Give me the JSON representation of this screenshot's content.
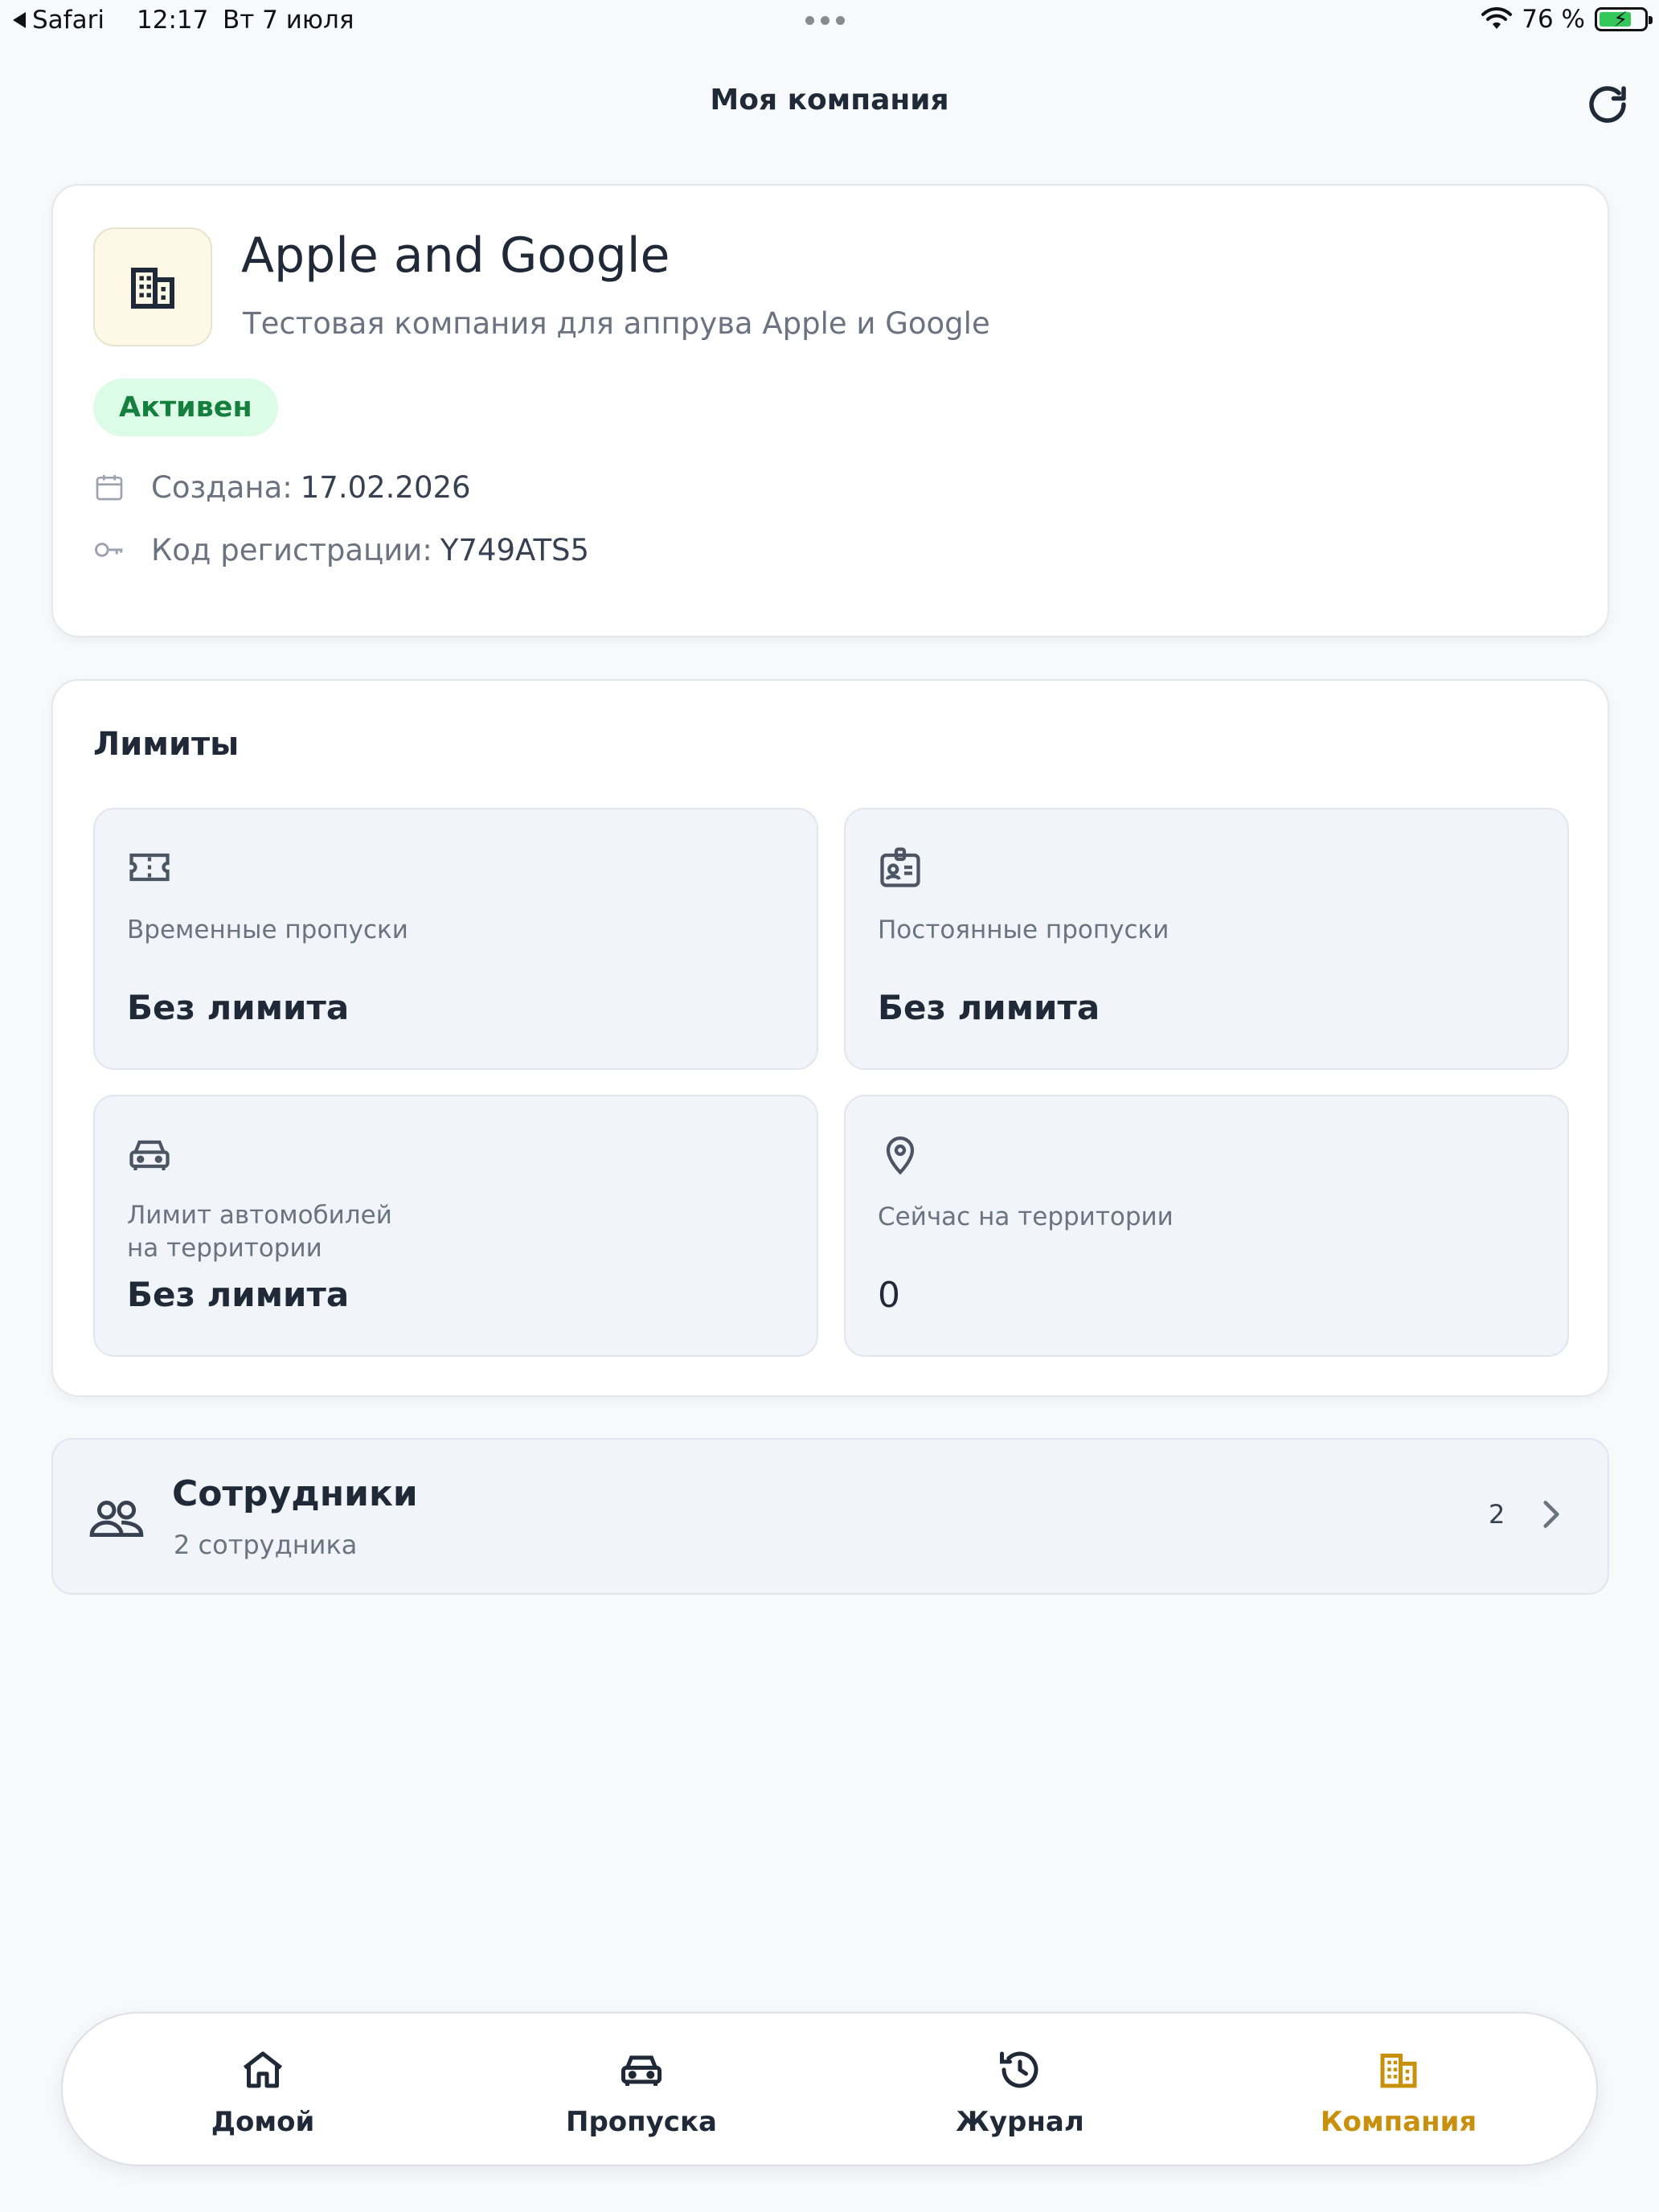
{
  "status_bar": {
    "back_app": "Safari",
    "time": "12:17",
    "date": "Вт 7 июля",
    "battery": "76 %"
  },
  "header": {
    "title": "Моя компания",
    "refresh_icon": "refresh-icon"
  },
  "company": {
    "name": "Apple and Google",
    "description": "Тестовая компания для аппрува Apple и Google",
    "status": "Активен",
    "created_label": "Создана:",
    "created_value": "17.02.2026",
    "code_label": "Код регистрации:",
    "code_value": "Y749ATS5",
    "logo_icon": "building-icon"
  },
  "limits": {
    "title": "Лимиты",
    "tiles": [
      {
        "icon": "ticket-icon",
        "label": "Временные пропуски",
        "value": "Без лимита"
      },
      {
        "icon": "id-badge-icon",
        "label": "Постоянные пропуски",
        "value": "Без лимита"
      },
      {
        "icon": "car-icon",
        "label_line1": "Лимит автомобилей",
        "label_line2": "на территории",
        "value": "Без лимита"
      },
      {
        "icon": "map-pin-icon",
        "label": "Сейчас на территории",
        "value": "0"
      }
    ]
  },
  "employees": {
    "title": "Сотрудники",
    "subtitle": "2 сотрудника",
    "count": "2",
    "icon": "users-icon"
  },
  "bottom_nav": {
    "items": [
      {
        "label": "Домой",
        "icon": "home-icon"
      },
      {
        "label": "Пропуска",
        "icon": "car-icon"
      },
      {
        "label": "Журнал",
        "icon": "history-icon"
      },
      {
        "label": "Компания",
        "icon": "building-icon"
      }
    ],
    "active_index": 3,
    "active_color": "#c8900c"
  },
  "colors": {
    "status_badge_bg": "#dcfce7",
    "status_badge_text": "#15803d",
    "logo_bg": "#fef9e7"
  }
}
